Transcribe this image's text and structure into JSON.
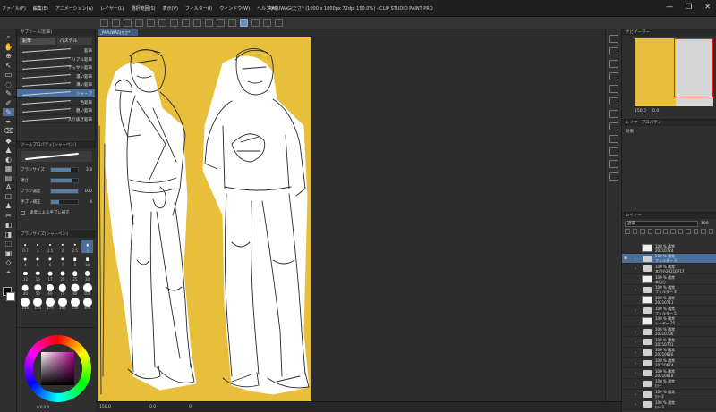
{
  "window": {
    "title": "_PAPUWAG(ださ* (1000 x 1000px 72dpi 150.0%) - CLIP STUDIO PAINT PRO",
    "menu": [
      "ファイル(F)",
      "編集(E)",
      "アニメーション(A)",
      "レイヤー(L)",
      "選択範囲(S)",
      "表示(V)",
      "フィルター(I)",
      "ウィンドウ(W)",
      "ヘルプ(H)"
    ],
    "controls": [
      "—",
      "❐",
      "✕"
    ]
  },
  "document_tab": "_PAPUWAG(ださ*",
  "subtool": {
    "header": "サブツール[鉛筆]",
    "tabs": [
      "鉛筆",
      "パステル"
    ],
    "brushes": [
      "鉛筆",
      "リアル鉛筆",
      "デッサン鉛筆",
      "濃い鉛筆",
      "薄い鉛筆",
      "シャープ",
      "色鉛筆",
      "粗い鉛筆",
      "入り抜き鉛筆"
    ],
    "selected_index": 5
  },
  "toolprop": {
    "header": "ツールプロパティ[シャーペン]",
    "rows": [
      {
        "label": "ブラシサイズ",
        "value": "3.8",
        "fill": 0.72
      },
      {
        "label": "硬さ",
        "value": "",
        "fill": 0.8
      },
      {
        "label": "ブラシ濃度",
        "value": "100",
        "fill": 1.0
      },
      {
        "label": "手ブレ補正",
        "value": "4",
        "fill": 0.3
      }
    ],
    "checkbox_label": "速度による手ブレ補正"
  },
  "brushsize": {
    "header": "ブラシサイズ[シャーペン]",
    "sizes": [
      "0.7",
      "1",
      "1.5",
      "2",
      "2.5",
      "3",
      "4",
      "5",
      "6",
      "7",
      "8",
      "10",
      "12",
      "15",
      "17",
      "20",
      "25",
      "30",
      "40",
      "50",
      "60",
      "70",
      "80",
      "100",
      "120",
      "150",
      "170",
      "200",
      "250",
      "300"
    ],
    "selected_index": 5
  },
  "color": {
    "hsv_readout": "0 0 0 0",
    "main_color": "#000000",
    "sub_color": "#ffffff"
  },
  "canvas": {
    "background": "#e8bf3a"
  },
  "status": {
    "zoom": "150.0",
    "angle": "0.0",
    "extra": "0"
  },
  "navigator": {
    "header": "ナビゲーター",
    "zoom": "150.0",
    "angle": "0.0"
  },
  "layerprop": {
    "header": "レイヤープロパティ",
    "effect_label": "効果"
  },
  "layers": {
    "header": "レイヤー",
    "blend_mode": "通常",
    "opacity": "100",
    "items": [
      {
        "type": "layer",
        "line1": "100 % 通常",
        "line2": "20210724",
        "visible": false,
        "selected": false
      },
      {
        "type": "folder",
        "line1": "100 % 通常",
        "line2": "フォルダー 3",
        "visible": true,
        "selected": true
      },
      {
        "type": "folder",
        "line1": "100 % 通常",
        "line2": "本日分20210717",
        "visible": false,
        "selected": false
      },
      {
        "type": "layer",
        "line1": "100 % 通常",
        "line2": "本日分",
        "visible": false,
        "selected": false
      },
      {
        "type": "folder",
        "line1": "100 % 通常",
        "line2": "フォルダー 4",
        "visible": false,
        "selected": false
      },
      {
        "type": "layer",
        "line1": "100 % 通常",
        "line2": "20210711",
        "visible": false,
        "selected": false
      },
      {
        "type": "folder",
        "line1": "100 % 通常",
        "line2": "フォルダー 5",
        "visible": false,
        "selected": false
      },
      {
        "type": "layer",
        "line1": "100 % 通常",
        "line2": "レイヤー 25",
        "visible": false,
        "selected": false
      },
      {
        "type": "folder",
        "line1": "100 % 通常",
        "line2": "20210706",
        "visible": false,
        "selected": false
      },
      {
        "type": "folder",
        "line1": "100 % 通常",
        "line2": "20210701",
        "visible": false,
        "selected": false
      },
      {
        "type": "folder",
        "line1": "100 % 通常",
        "line2": "20210626",
        "visible": false,
        "selected": false
      },
      {
        "type": "folder",
        "line1": "100 % 通常",
        "line2": "20210624",
        "visible": false,
        "selected": false
      },
      {
        "type": "folder",
        "line1": "100 % 通常",
        "line2": "20210618",
        "visible": false,
        "selected": false
      },
      {
        "type": "folder",
        "line1": "100 % 通常",
        "line2": "ｶﾗｰ",
        "visible": false,
        "selected": false
      },
      {
        "type": "folder",
        "line1": "100 % 通常",
        "line2": "ｶﾗｰ 2",
        "visible": false,
        "selected": false
      },
      {
        "type": "folder",
        "line1": "100 % 通常",
        "line2": "ｶﾗｰ 3",
        "visible": false,
        "selected": false
      }
    ]
  }
}
